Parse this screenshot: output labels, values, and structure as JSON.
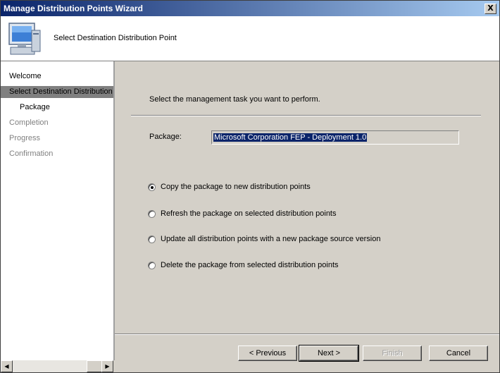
{
  "window": {
    "title": "Manage Distribution Points Wizard",
    "close_label": "X"
  },
  "header": {
    "title": "Select Destination Distribution Point",
    "icon": "computer-icon"
  },
  "nav": {
    "items": [
      {
        "label": "Welcome",
        "state": "normal"
      },
      {
        "label": "Select Destination Distribution Point",
        "state": "active"
      },
      {
        "label": "Package",
        "state": "sub"
      },
      {
        "label": "Completion",
        "state": "disabled"
      },
      {
        "label": "Progress",
        "state": "disabled"
      },
      {
        "label": "Confirmation",
        "state": "disabled"
      }
    ]
  },
  "main": {
    "prompt": "Select the management task you want to perform.",
    "package_label": "Package:",
    "package_value": "Microsoft Corporation FEP - Deployment 1.0",
    "options": [
      {
        "label": "Copy the package to new distribution points",
        "checked": true
      },
      {
        "label": "Refresh the package on selected distribution points",
        "checked": false
      },
      {
        "label": "Update all distribution points with a new package source version",
        "checked": false
      },
      {
        "label": "Delete the package from selected distribution points",
        "checked": false
      }
    ]
  },
  "buttons": {
    "previous": "< Previous",
    "next": "Next >",
    "finish": "Finish",
    "cancel": "Cancel"
  },
  "colors": {
    "title_start": "#0a246a",
    "title_end": "#a6caf0",
    "selection": "#0a246a",
    "nav_active": "#808080",
    "face": "#d4d0c8"
  }
}
